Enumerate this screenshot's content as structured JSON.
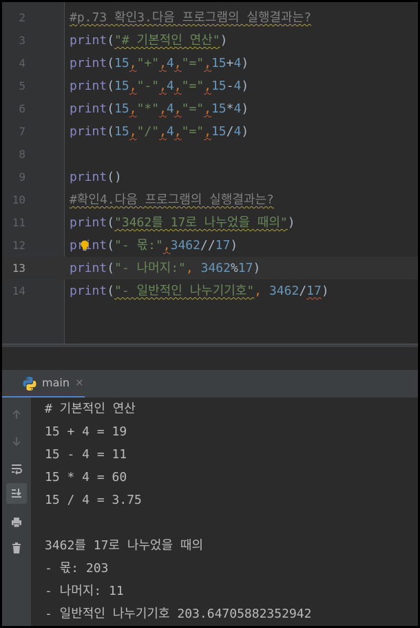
{
  "editor": {
    "lines": [
      {
        "num": "2"
      },
      {
        "num": "3"
      },
      {
        "num": "4"
      },
      {
        "num": "5"
      },
      {
        "num": "6"
      },
      {
        "num": "7"
      },
      {
        "num": "8"
      },
      {
        "num": "9"
      },
      {
        "num": "10"
      },
      {
        "num": "11"
      },
      {
        "num": "12"
      },
      {
        "num": "13"
      },
      {
        "num": "14"
      }
    ],
    "comment1": "#p.73 확인3.다음 프로그램의 실행결과는?",
    "comment2": "#확인4.다음 프로그램의 실행결과는?",
    "kw": "print",
    "s_basic": "\"# 기본적인 연산\"",
    "n15": "15",
    "n4": "4",
    "n3462": "3462",
    "n17": "17",
    "s_plus": "\"+\"",
    "s_minus": "\"-\"",
    "s_mul": "\"*\"",
    "s_div": "\"/\"",
    "s_eq": "\"=\"",
    "s_divide17": "\"3462를 17로 나누었을 때의\"",
    "s_quot": "\"- 몫:\"",
    "s_rem": "\"- 나머지:\"",
    "s_plain": "\"- 일반적인 나누기기호\""
  },
  "run": {
    "tab_label": "main",
    "close_glyph": "×",
    "output": [
      "# 기본적인 연산",
      "15 + 4 = 19",
      "15 - 4 = 11",
      "15 * 4 = 60",
      "15 / 4 = 3.75",
      "",
      "3462를 17로 나누었을 때의",
      "- 몫: 203",
      "- 나머지: 11",
      "- 일반적인 나누기기호 203.64705882352942"
    ]
  },
  "icons": {
    "toolbar": [
      "arrow-up-icon",
      "arrow-down-icon",
      "soft-wrap-icon",
      "scroll-to-end-icon",
      "print-icon",
      "trash-icon"
    ],
    "editor": [
      "bulb-icon"
    ],
    "run": [
      "python-icon",
      "close-icon"
    ]
  },
  "colors": {
    "keyword": "#8888c6",
    "string": "#6a8759",
    "number": "#6897bb",
    "comma": "#cc7832",
    "comment": "#808080",
    "accent": "#4a88c7"
  }
}
